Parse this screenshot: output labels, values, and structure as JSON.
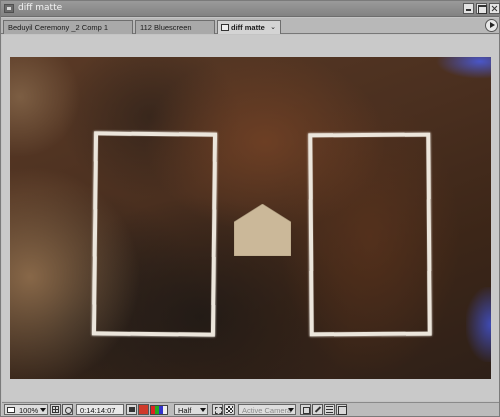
{
  "window": {
    "title": "diff matte"
  },
  "tabs": [
    {
      "label": "Beduyil Ceremony _2 Comp 1"
    },
    {
      "label": "112 Bluescreen"
    },
    {
      "label": "diff matte",
      "close_glyph": "⌄",
      "active": true
    }
  ],
  "toolbar": {
    "zoom": "100%",
    "timecode": "0:14:14:07",
    "resolution": "Half",
    "camera": "Active Camera"
  },
  "icons": {
    "title": "window-icon",
    "tabs_menu": "arrow-right-icon"
  }
}
